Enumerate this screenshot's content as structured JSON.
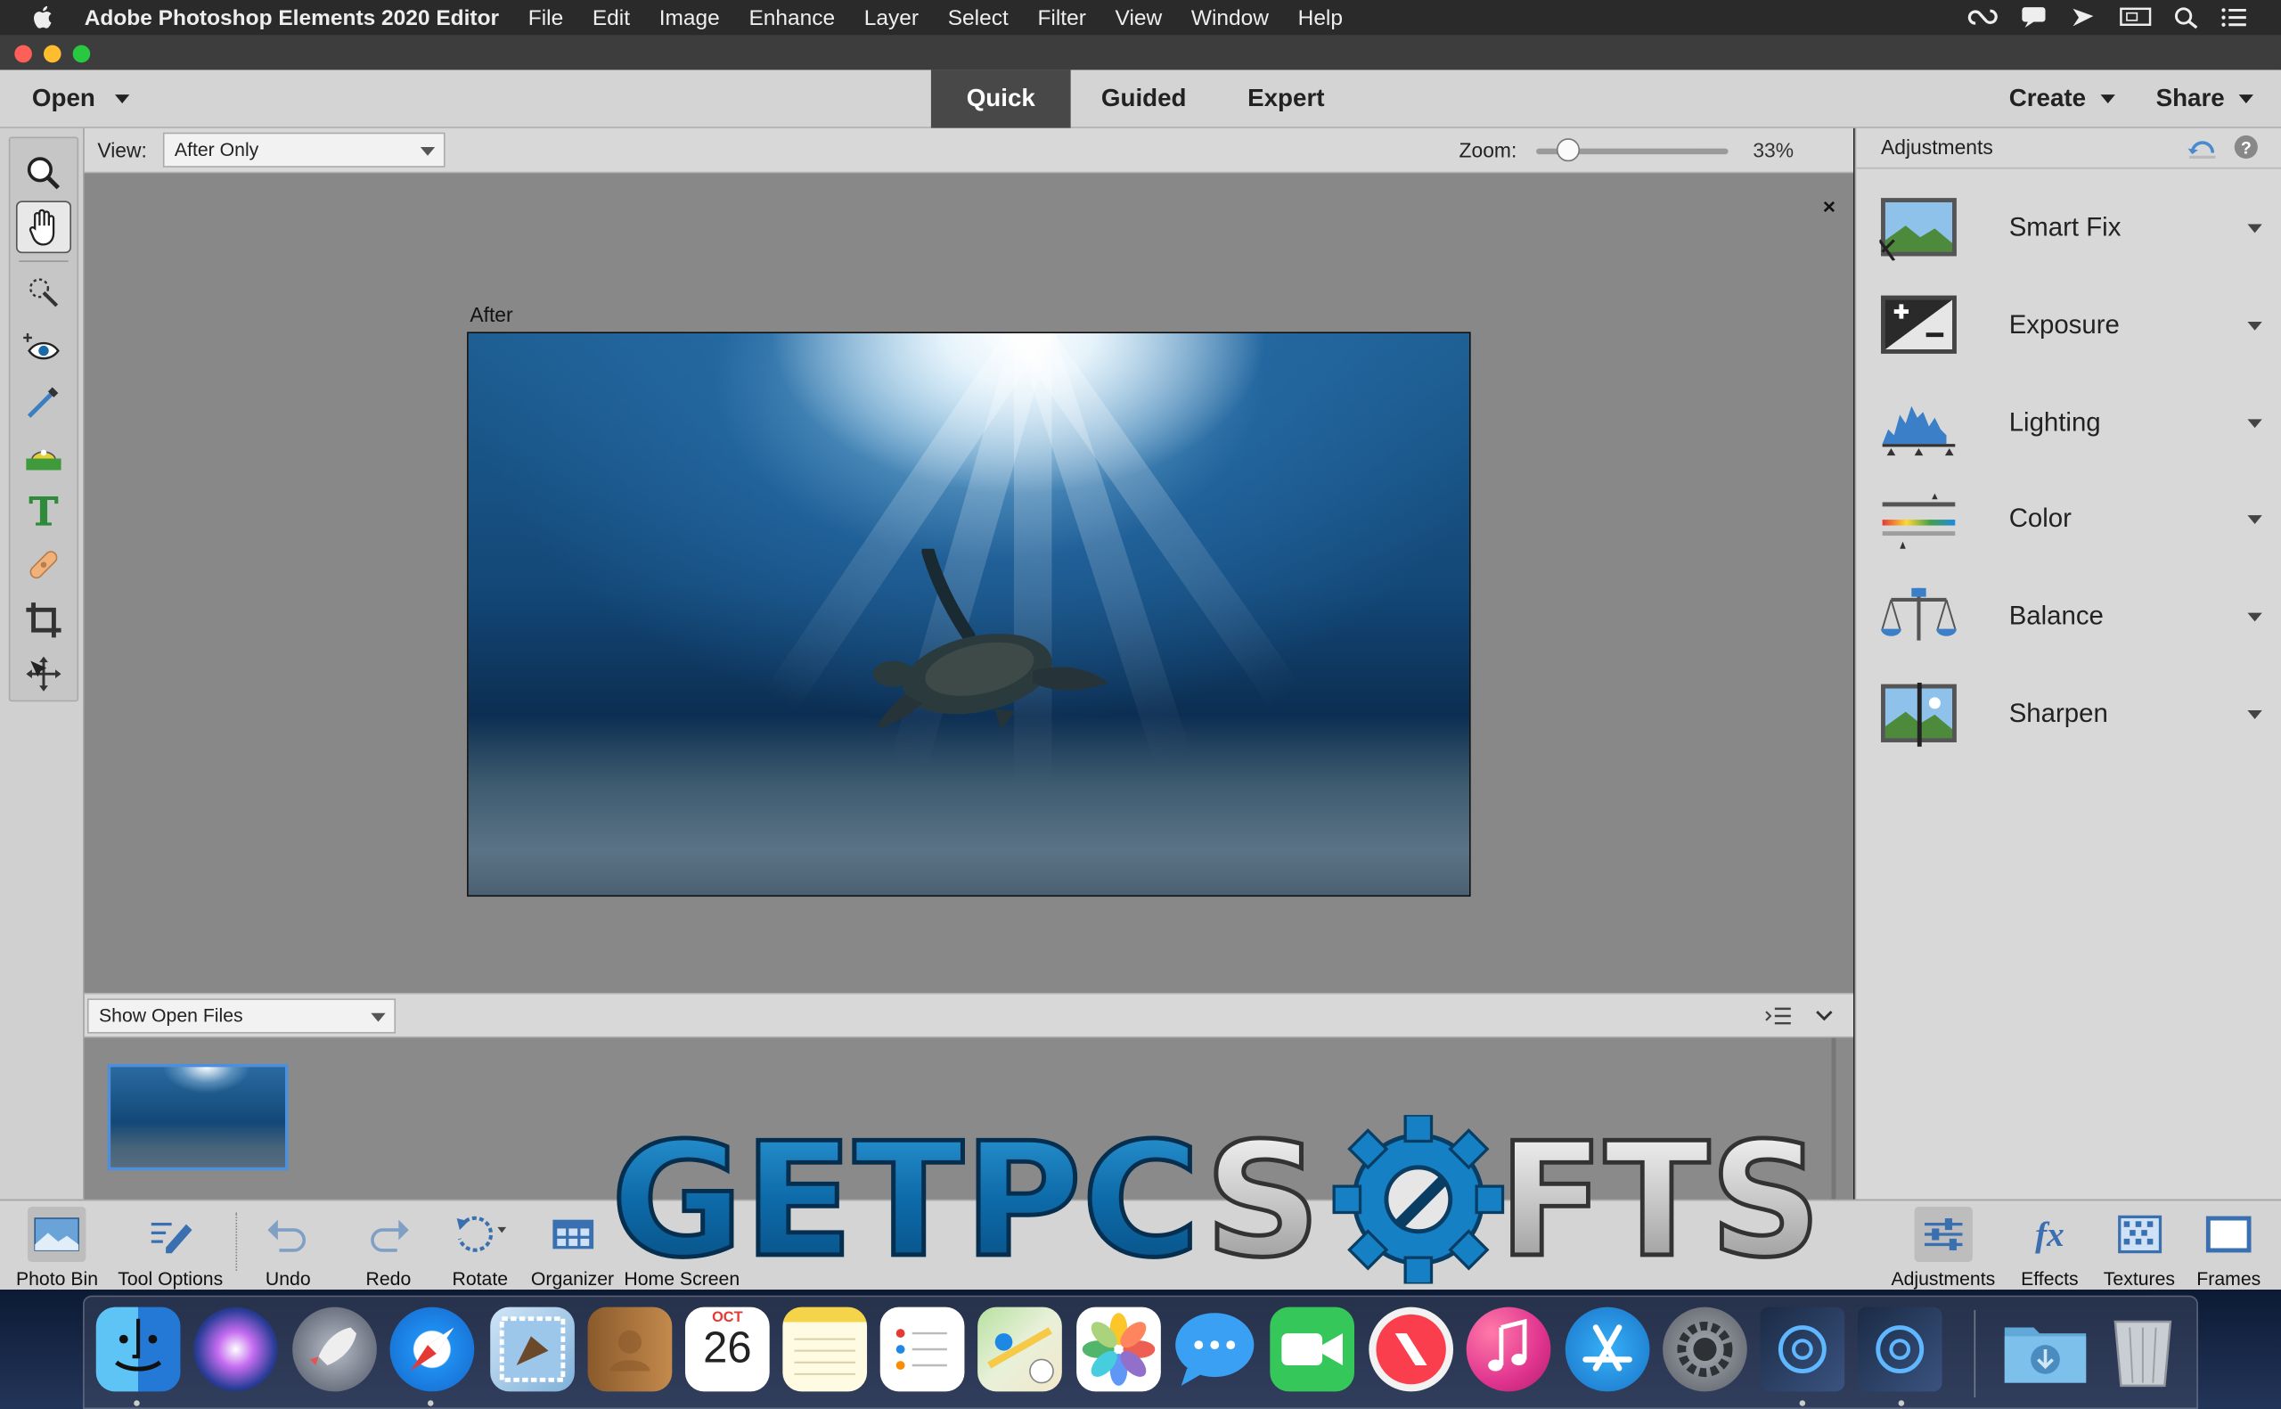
{
  "menubar": {
    "app_name": "Adobe Photoshop Elements 2020 Editor",
    "items": [
      "File",
      "Edit",
      "Image",
      "Enhance",
      "Layer",
      "Select",
      "Filter",
      "View",
      "Window",
      "Help"
    ],
    "status_icons": [
      "creative-cloud-icon",
      "notification-icon",
      "airplay-icon",
      "display-icon",
      "spotlight-search-icon",
      "control-center-icon"
    ]
  },
  "topbar": {
    "open_label": "Open",
    "modes": [
      {
        "label": "Quick",
        "active": true
      },
      {
        "label": "Guided",
        "active": false
      },
      {
        "label": "Expert",
        "active": false
      }
    ],
    "create_label": "Create",
    "share_label": "Share"
  },
  "tools": [
    {
      "name": "zoom-tool",
      "icon": "magnifier-icon",
      "active": false
    },
    {
      "name": "hand-tool",
      "icon": "hand-icon",
      "active": true
    },
    {
      "name": "quick-selection-tool",
      "icon": "quick-selection-icon",
      "active": false
    },
    {
      "name": "red-eye-tool",
      "icon": "eye-icon",
      "active": false
    },
    {
      "name": "whiten-teeth-tool",
      "icon": "brush-icon",
      "active": false
    },
    {
      "name": "straighten-tool",
      "icon": "straighten-icon",
      "active": false
    },
    {
      "name": "type-tool",
      "icon": "type-icon",
      "active": false
    },
    {
      "name": "spot-healing-tool",
      "icon": "bandage-icon",
      "active": false
    },
    {
      "name": "crop-tool",
      "icon": "crop-icon",
      "active": false
    },
    {
      "name": "move-tool",
      "icon": "move-icon",
      "active": false
    }
  ],
  "viewbar": {
    "view_label": "View:",
    "view_value": "After Only",
    "zoom_label": "Zoom:",
    "zoom_value": "33%",
    "zoom_fraction": 0.12
  },
  "canvas": {
    "close_glyph": "×",
    "after_label": "After"
  },
  "bin": {
    "show_label": "Show Open Files"
  },
  "adjustments": {
    "title": "Adjustments",
    "items": [
      {
        "label": "Smart Fix",
        "icon": "smart-fix-icon"
      },
      {
        "label": "Exposure",
        "icon": "exposure-icon"
      },
      {
        "label": "Lighting",
        "icon": "lighting-icon"
      },
      {
        "label": "Color",
        "icon": "color-icon"
      },
      {
        "label": "Balance",
        "icon": "balance-icon"
      },
      {
        "label": "Sharpen",
        "icon": "sharpen-icon"
      }
    ]
  },
  "actionbar": {
    "left": [
      {
        "label": "Photo Bin",
        "icon": "photo-bin-icon",
        "pressed": true
      },
      {
        "label": "Tool Options",
        "icon": "tool-options-icon",
        "pressed": false
      },
      {
        "label": "Undo",
        "icon": "undo-icon",
        "pressed": false
      },
      {
        "label": "Redo",
        "icon": "redo-icon",
        "pressed": false
      },
      {
        "label": "Rotate",
        "icon": "rotate-icon",
        "pressed": false
      },
      {
        "label": "Organizer",
        "icon": "organizer-icon",
        "pressed": false
      },
      {
        "label": "Home Screen",
        "icon": "home-screen-icon",
        "pressed": false
      }
    ],
    "right": [
      {
        "label": "Adjustments",
        "icon": "adjustments-icon",
        "pressed": true
      },
      {
        "label": "Effects",
        "icon": "fx-icon",
        "pressed": false
      },
      {
        "label": "Textures",
        "icon": "textures-icon",
        "pressed": false
      },
      {
        "label": "Frames",
        "icon": "frames-icon",
        "pressed": false
      }
    ]
  },
  "watermark": {
    "text_left": "GETPC",
    "text_right": "S",
    "text_end": "FTS"
  },
  "dock": {
    "apps": [
      "finder",
      "siri",
      "launchpad",
      "safari",
      "mail",
      "contacts",
      "calendar",
      "notes",
      "reminders",
      "maps",
      "photos",
      "messages",
      "facetime",
      "news",
      "music",
      "app-store",
      "system-preferences",
      "photoshop-elements-editor",
      "photoshop-elements-organizer",
      "downloads",
      "trash"
    ],
    "calendar_month": "OCT",
    "calendar_day": "26"
  },
  "colors": {
    "accent_blue": "#1a73c9",
    "mode_active_bg": "#484848",
    "canvas_bg": "#888888"
  }
}
